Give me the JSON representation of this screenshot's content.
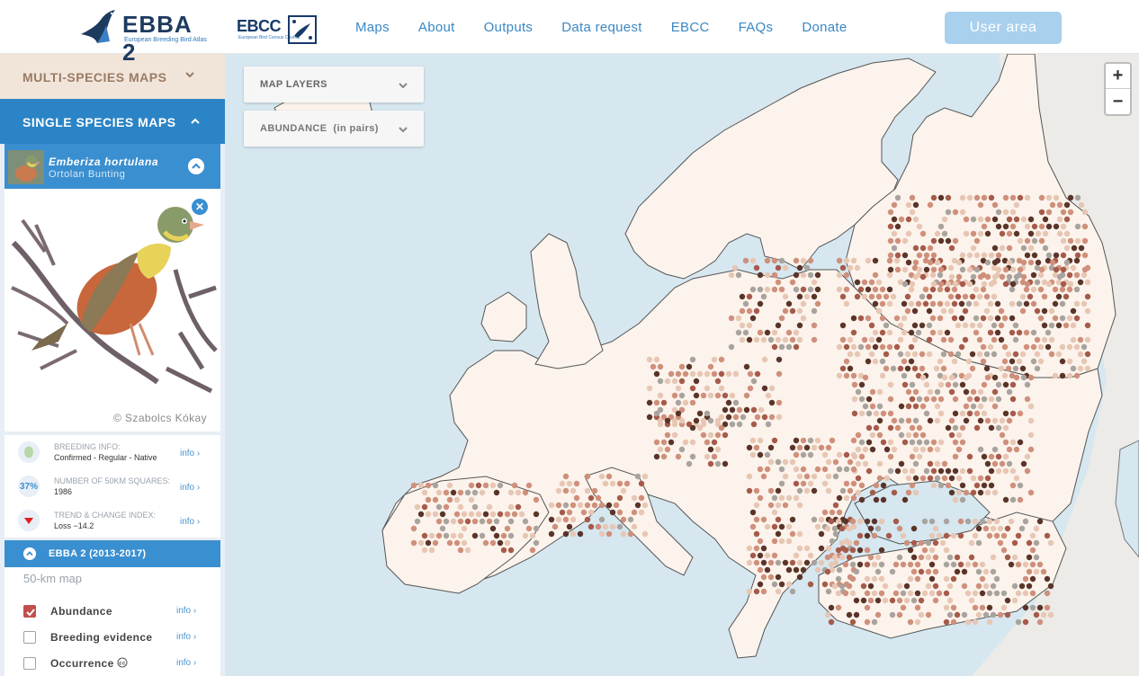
{
  "header": {
    "logo_ebba_text": "EBBA 2",
    "logo_ebba_sub": "European Breeding Bird Atlas",
    "logo_ebcc_text": "EBCC",
    "logo_ebcc_sub": "European Bird Census Council",
    "nav": [
      "Maps",
      "About",
      "Outputs",
      "Data request",
      "EBCC",
      "FAQs",
      "Donate"
    ],
    "user_area": "User area"
  },
  "sidebar": {
    "multi_label": "MULTI-SPECIES MAPS",
    "single_label": "SINGLE SPECIES MAPS",
    "species": {
      "latin": "Emberiza hortulana",
      "common": "Ortolan Bunting",
      "photo_credit": "© Szabolcs Kókay"
    },
    "info_rows": [
      {
        "icon": "breeding-icon",
        "label": "BREEDING INFO:",
        "value": "Confirmed - Regular - Native",
        "more": "info ›"
      },
      {
        "icon": "percent-badge",
        "badge": "37%",
        "label": "NUMBER OF 50KM SQUARES:",
        "value": "1986",
        "more": "info ›"
      },
      {
        "icon": "trend-down-icon",
        "label": "TREND & CHANGE INDEX:",
        "value": "Loss −14.2",
        "more": "info ›"
      }
    ],
    "ebba_bar": "EBBA 2 (2013-2017)",
    "layers_subtitle": "50-km map",
    "layers": [
      {
        "label": "Abundance",
        "checked": true,
        "more": "info ›"
      },
      {
        "label": "Breeding evidence",
        "checked": false,
        "more": "info ›"
      },
      {
        "label": "Occurrence",
        "checked": false,
        "more": "info ›"
      }
    ]
  },
  "map": {
    "layers_control": "MAP LAYERS",
    "abundance_control": "ABUNDANCE",
    "abundance_unit": "(in pairs)",
    "zoom_in": "+",
    "zoom_out": "−",
    "colors": {
      "sea": "#d6e7f0",
      "land": "#fbf3ec",
      "abundance_low": "#e7c6b3",
      "abundance_mid": "#cf8f7a",
      "abundance_high": "#a65a4a",
      "abundance_max": "#5a3428",
      "absent": "#a8a39d"
    }
  }
}
